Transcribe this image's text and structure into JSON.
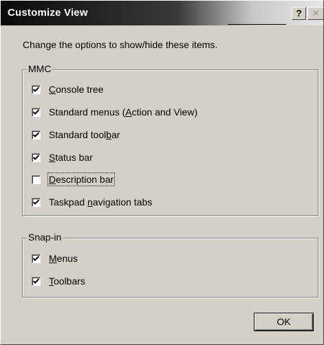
{
  "window": {
    "title": "Customize View",
    "help_label": "?",
    "close_label": "×"
  },
  "intro_text": "Change the options to show/hide these items.",
  "mmc": {
    "legend": "MMC",
    "options": [
      {
        "pre": "",
        "key": "C",
        "post": "onsole tree",
        "checked": true
      },
      {
        "pre": "Standard menus (",
        "key": "A",
        "post": "ction and View)",
        "checked": true
      },
      {
        "pre": "Standard tool",
        "key": "b",
        "post": "ar",
        "checked": true
      },
      {
        "pre": "",
        "key": "S",
        "post": "tatus bar",
        "checked": true
      },
      {
        "pre": "",
        "key": "D",
        "post": "escription bar",
        "checked": false
      },
      {
        "pre": "Taskpad ",
        "key": "n",
        "post": "avigation tabs",
        "checked": true
      }
    ]
  },
  "snapin": {
    "legend": "Snap-in",
    "options": [
      {
        "pre": "",
        "key": "M",
        "post": "enus",
        "checked": true
      },
      {
        "pre": "",
        "key": "T",
        "post": "oolbars",
        "checked": true
      }
    ]
  },
  "ok_label": "OK"
}
